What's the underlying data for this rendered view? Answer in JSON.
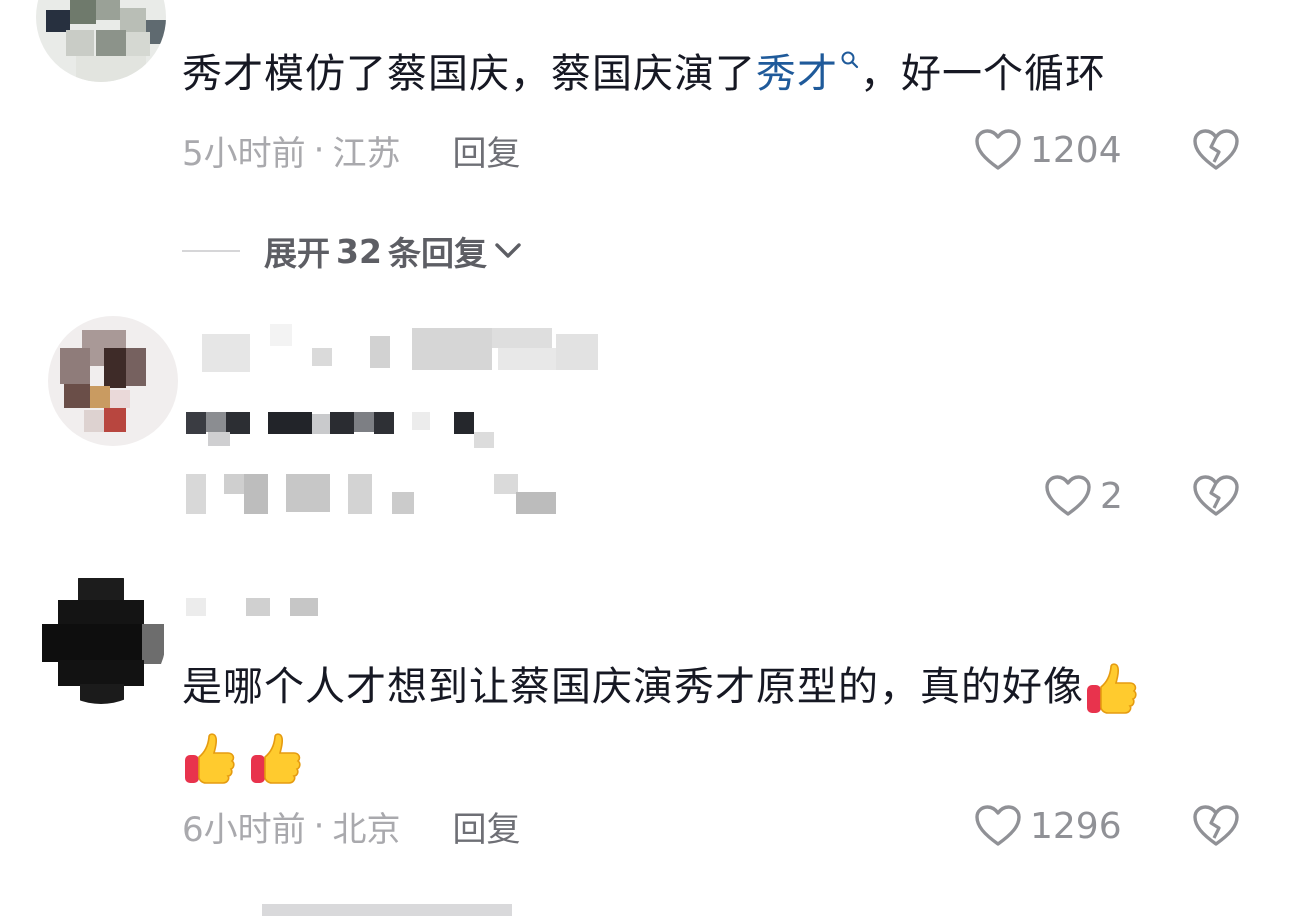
{
  "comments": [
    {
      "text_pre": "秀才模仿了蔡国庆，蔡国庆演了",
      "text_link": "秀才",
      "text_post": "，好一个循环",
      "time": "5小时前",
      "location": "江苏",
      "reply_label": "回复",
      "likes": "1204"
    },
    {
      "likes": "2"
    },
    {
      "text": "是哪个人才想到让蔡国庆演秀才原型的，真的好像",
      "emojis": [
        "thumbs-up",
        "thumbs-up",
        "thumbs-up"
      ],
      "time": "6小时前",
      "location": "北京",
      "reply_label": "回复",
      "likes": "1296"
    }
  ],
  "expand_replies": {
    "label_pre": "展开",
    "count": "32",
    "label_post": "条回复"
  },
  "meta_separator": "·",
  "colors": {
    "link": "#1f5a9a",
    "meta": "#a9a9ad",
    "icon": "#909196"
  },
  "icons": [
    "search-icon",
    "heart-outline-icon",
    "broken-heart-icon",
    "chevron-down-icon",
    "thumbs-up-emoji"
  ]
}
